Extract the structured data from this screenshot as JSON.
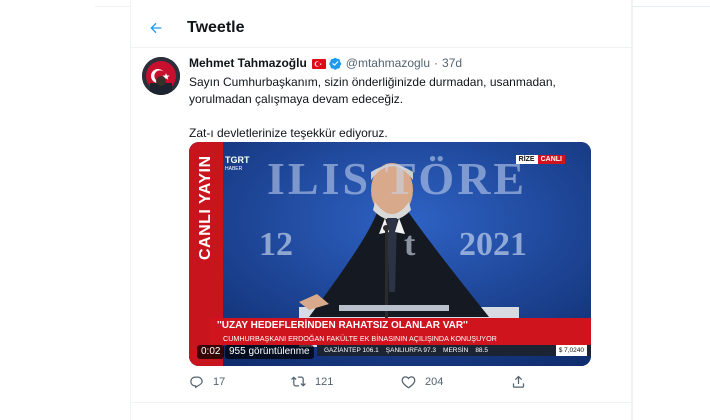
{
  "header": {
    "title": "Tweetle",
    "back_icon": "arrow-left-icon"
  },
  "tweet": {
    "author_name": "Mehmet Tahmazoğlu",
    "handle": "@mtahmazoglu",
    "separator": "·",
    "time": "37d",
    "flag_icon": "turkey-flag-icon",
    "verified_icon": "verified-badge-icon",
    "text_line1": "Sayın Cumhurbaşkanım, sizin önderliğinizde durmadan, usanmadan,",
    "text_line2": "yorulmadan çalışmaya devam edeceğiz.",
    "text_line3": "Zat-ı devletlerinize teşekkür ediyoruz."
  },
  "media": {
    "channel_logo": "TGRT",
    "channel_sub": "HABER",
    "location": "RİZE",
    "live_badge": "CANLI",
    "live_vertical": "CANLI YAYIN",
    "backdrop_text": "ILIS TÖRE",
    "backdrop_year_left": "12",
    "backdrop_year_mid": "t",
    "backdrop_year_right": "2021",
    "headline": "''UZAY HEDEFLERİNDEN RAHATSIZ OLANLAR VAR''",
    "subheadline": "CUMHURBAŞKANI ERDOĞAN FAKÜLTE EK BİNASININ AÇILIŞINDA KONUŞUYOR",
    "ticker": [
      "GAZİANTEP 106.1",
      "ŞANLIURFA 97.3",
      "MERSİN",
      "88.5"
    ],
    "ticker_last": "$ 7,0240",
    "duration": "0:02",
    "views": "955 görüntülenme"
  },
  "actions": {
    "reply_count": "17",
    "retweet_count": "121",
    "like_count": "204",
    "reply_icon": "reply-icon",
    "retweet_icon": "retweet-icon",
    "like_icon": "heart-icon",
    "share_icon": "share-icon"
  },
  "colors": {
    "accent": "#1d9bf0",
    "text": "#0f1419",
    "muted": "#536471",
    "news_red": "#d0141e",
    "stage_blue": "#163a86"
  }
}
